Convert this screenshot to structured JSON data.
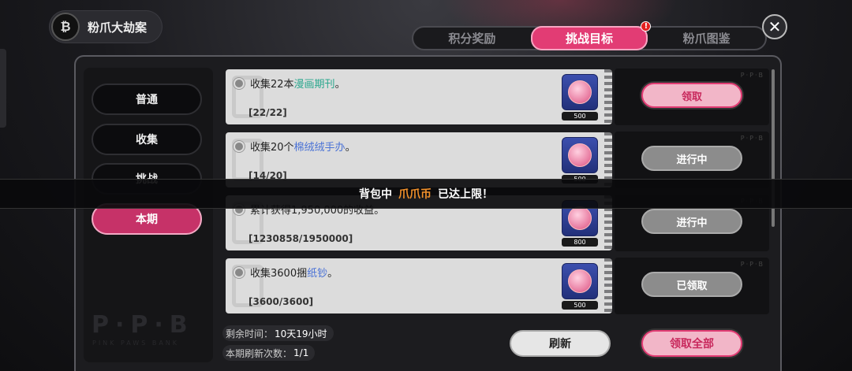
{
  "header": {
    "title": "粉爪大劫案",
    "close_label": "✕"
  },
  "tabs": [
    {
      "label": "积分奖励",
      "active": false
    },
    {
      "label": "挑战目标",
      "active": true,
      "badge": "!"
    },
    {
      "label": "粉爪图鉴",
      "active": false
    }
  ],
  "sidebar": {
    "categories": [
      {
        "label": "普通",
        "active": false
      },
      {
        "label": "收集",
        "active": false
      },
      {
        "label": "挑战",
        "active": false
      },
      {
        "label": "本期",
        "active": true
      }
    ],
    "watermark": "P·P·B",
    "watermark_sub": "PINK PAWS BANK"
  },
  "tasks": [
    {
      "desc_prefix": "收集22本",
      "desc_highlight": "漫画期刊",
      "desc_suffix": "。",
      "progress": "[22/22]",
      "reward_qty": "500",
      "action": "领取",
      "state": "claimable"
    },
    {
      "desc_prefix": "收集20个",
      "desc_highlight": "棉绒绒手办",
      "desc_suffix": "。",
      "progress": "[14/20]",
      "reward_qty": "500",
      "action": "进行中",
      "state": "in_progress"
    },
    {
      "desc_prefix": "累计获得1,950,000的收益。",
      "desc_highlight": "",
      "desc_suffix": "",
      "progress": "[1230858/1950000]",
      "reward_qty": "800",
      "action": "进行中",
      "state": "in_progress"
    },
    {
      "desc_prefix": "收集3600捆",
      "desc_highlight": "纸钞",
      "desc_suffix": "。",
      "progress": "[3600/3600]",
      "reward_qty": "500",
      "action": "已领取",
      "state": "claimed"
    }
  ],
  "slot_tag": "P·P·B",
  "toast": {
    "prefix": "背包中",
    "item": "爪爪币",
    "suffix": "已达上限！"
  },
  "footer": {
    "remaining_label": "剩余时间：",
    "remaining_value": "10天19小时",
    "refresh_count_label": "本期刷新次数：",
    "refresh_count_value": "1/1",
    "refresh_button": "刷新",
    "claim_all_button": "领取全部"
  },
  "colors": {
    "accent": "#e23c74",
    "highlight_orange": "#f0902b",
    "highlight_green": "#2aa78e",
    "highlight_blue": "#4a72d6"
  }
}
